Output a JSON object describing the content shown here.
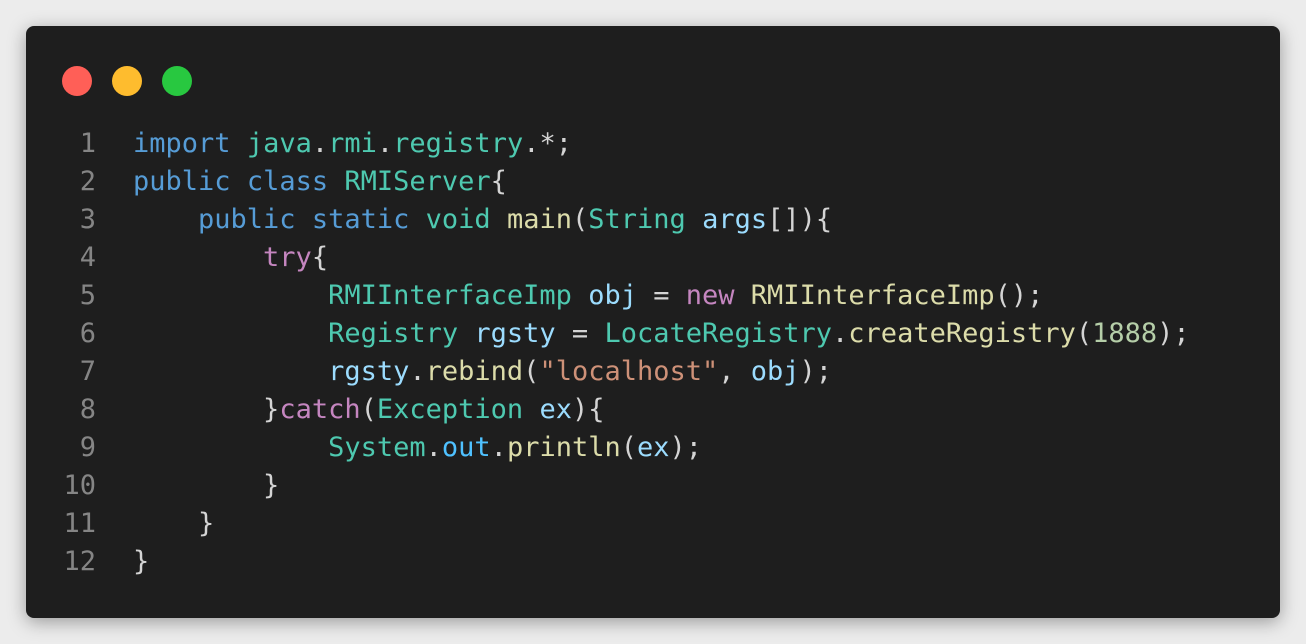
{
  "window": {
    "controls": [
      {
        "name": "close",
        "color": "#ff5f57"
      },
      {
        "name": "minimize",
        "color": "#febc2e"
      },
      {
        "name": "maximize",
        "color": "#28c840"
      }
    ]
  },
  "editor": {
    "colors": {
      "background": "#1e1e1e",
      "line_number": "#858585",
      "keyword": "#569cd6",
      "control": "#c586c0",
      "type": "#4ec9b0",
      "function": "#dcdcaa",
      "variable": "#9cdcfe",
      "string": "#ce9178",
      "number": "#b5cea8"
    },
    "lines": [
      {
        "number": "1",
        "tokens": [
          {
            "t": "import",
            "c": "kw"
          },
          {
            "t": " ",
            "c": "pun"
          },
          {
            "t": "java",
            "c": "type"
          },
          {
            "t": ".",
            "c": "pun"
          },
          {
            "t": "rmi",
            "c": "type"
          },
          {
            "t": ".",
            "c": "pun"
          },
          {
            "t": "registry",
            "c": "type"
          },
          {
            "t": ".*;",
            "c": "pun"
          }
        ]
      },
      {
        "number": "2",
        "tokens": [
          {
            "t": "public",
            "c": "kw"
          },
          {
            "t": " ",
            "c": "pun"
          },
          {
            "t": "class",
            "c": "kw"
          },
          {
            "t": " ",
            "c": "pun"
          },
          {
            "t": "RMIServer",
            "c": "type"
          },
          {
            "t": "{",
            "c": "pun"
          }
        ]
      },
      {
        "number": "3",
        "tokens": [
          {
            "t": "    ",
            "c": "pun"
          },
          {
            "t": "public",
            "c": "kw"
          },
          {
            "t": " ",
            "c": "pun"
          },
          {
            "t": "static",
            "c": "kw"
          },
          {
            "t": " ",
            "c": "pun"
          },
          {
            "t": "void",
            "c": "type"
          },
          {
            "t": " ",
            "c": "pun"
          },
          {
            "t": "main",
            "c": "fn"
          },
          {
            "t": "(",
            "c": "pun"
          },
          {
            "t": "String",
            "c": "type"
          },
          {
            "t": " ",
            "c": "pun"
          },
          {
            "t": "args",
            "c": "var"
          },
          {
            "t": "[]){",
            "c": "pun"
          }
        ]
      },
      {
        "number": "4",
        "tokens": [
          {
            "t": "        ",
            "c": "pun"
          },
          {
            "t": "try",
            "c": "ctl"
          },
          {
            "t": "{",
            "c": "pun"
          }
        ]
      },
      {
        "number": "5",
        "tokens": [
          {
            "t": "            ",
            "c": "pun"
          },
          {
            "t": "RMIInterfaceImp",
            "c": "type"
          },
          {
            "t": " ",
            "c": "pun"
          },
          {
            "t": "obj",
            "c": "var"
          },
          {
            "t": " = ",
            "c": "pun"
          },
          {
            "t": "new",
            "c": "ctl"
          },
          {
            "t": " ",
            "c": "pun"
          },
          {
            "t": "RMIInterfaceImp",
            "c": "fn"
          },
          {
            "t": "();",
            "c": "pun"
          }
        ]
      },
      {
        "number": "6",
        "tokens": [
          {
            "t": "            ",
            "c": "pun"
          },
          {
            "t": "Registry",
            "c": "type"
          },
          {
            "t": " ",
            "c": "pun"
          },
          {
            "t": "rgsty",
            "c": "var"
          },
          {
            "t": " = ",
            "c": "pun"
          },
          {
            "t": "LocateRegistry",
            "c": "type"
          },
          {
            "t": ".",
            "c": "pun"
          },
          {
            "t": "createRegistry",
            "c": "fn"
          },
          {
            "t": "(",
            "c": "pun"
          },
          {
            "t": "1888",
            "c": "num"
          },
          {
            "t": ");",
            "c": "pun"
          }
        ]
      },
      {
        "number": "7",
        "tokens": [
          {
            "t": "            ",
            "c": "pun"
          },
          {
            "t": "rgsty",
            "c": "var"
          },
          {
            "t": ".",
            "c": "pun"
          },
          {
            "t": "rebind",
            "c": "fn"
          },
          {
            "t": "(",
            "c": "pun"
          },
          {
            "t": "\"localhost\"",
            "c": "str"
          },
          {
            "t": ", ",
            "c": "pun"
          },
          {
            "t": "obj",
            "c": "var"
          },
          {
            "t": ");",
            "c": "pun"
          }
        ]
      },
      {
        "number": "8",
        "tokens": [
          {
            "t": "        ",
            "c": "pun"
          },
          {
            "t": "}",
            "c": "pun"
          },
          {
            "t": "catch",
            "c": "ctl"
          },
          {
            "t": "(",
            "c": "pun"
          },
          {
            "t": "Exception",
            "c": "type"
          },
          {
            "t": " ",
            "c": "pun"
          },
          {
            "t": "ex",
            "c": "var"
          },
          {
            "t": "){",
            "c": "pun"
          }
        ]
      },
      {
        "number": "9",
        "tokens": [
          {
            "t": "            ",
            "c": "pun"
          },
          {
            "t": "System",
            "c": "type"
          },
          {
            "t": ".",
            "c": "pun"
          },
          {
            "t": "out",
            "c": "field"
          },
          {
            "t": ".",
            "c": "pun"
          },
          {
            "t": "println",
            "c": "fn"
          },
          {
            "t": "(",
            "c": "pun"
          },
          {
            "t": "ex",
            "c": "var"
          },
          {
            "t": ");",
            "c": "pun"
          }
        ]
      },
      {
        "number": "10",
        "tokens": [
          {
            "t": "        ",
            "c": "pun"
          },
          {
            "t": "}",
            "c": "pun"
          }
        ]
      },
      {
        "number": "11",
        "tokens": [
          {
            "t": "    ",
            "c": "pun"
          },
          {
            "t": "}",
            "c": "pun"
          }
        ]
      },
      {
        "number": "12",
        "tokens": [
          {
            "t": "}",
            "c": "pun"
          }
        ]
      }
    ]
  }
}
